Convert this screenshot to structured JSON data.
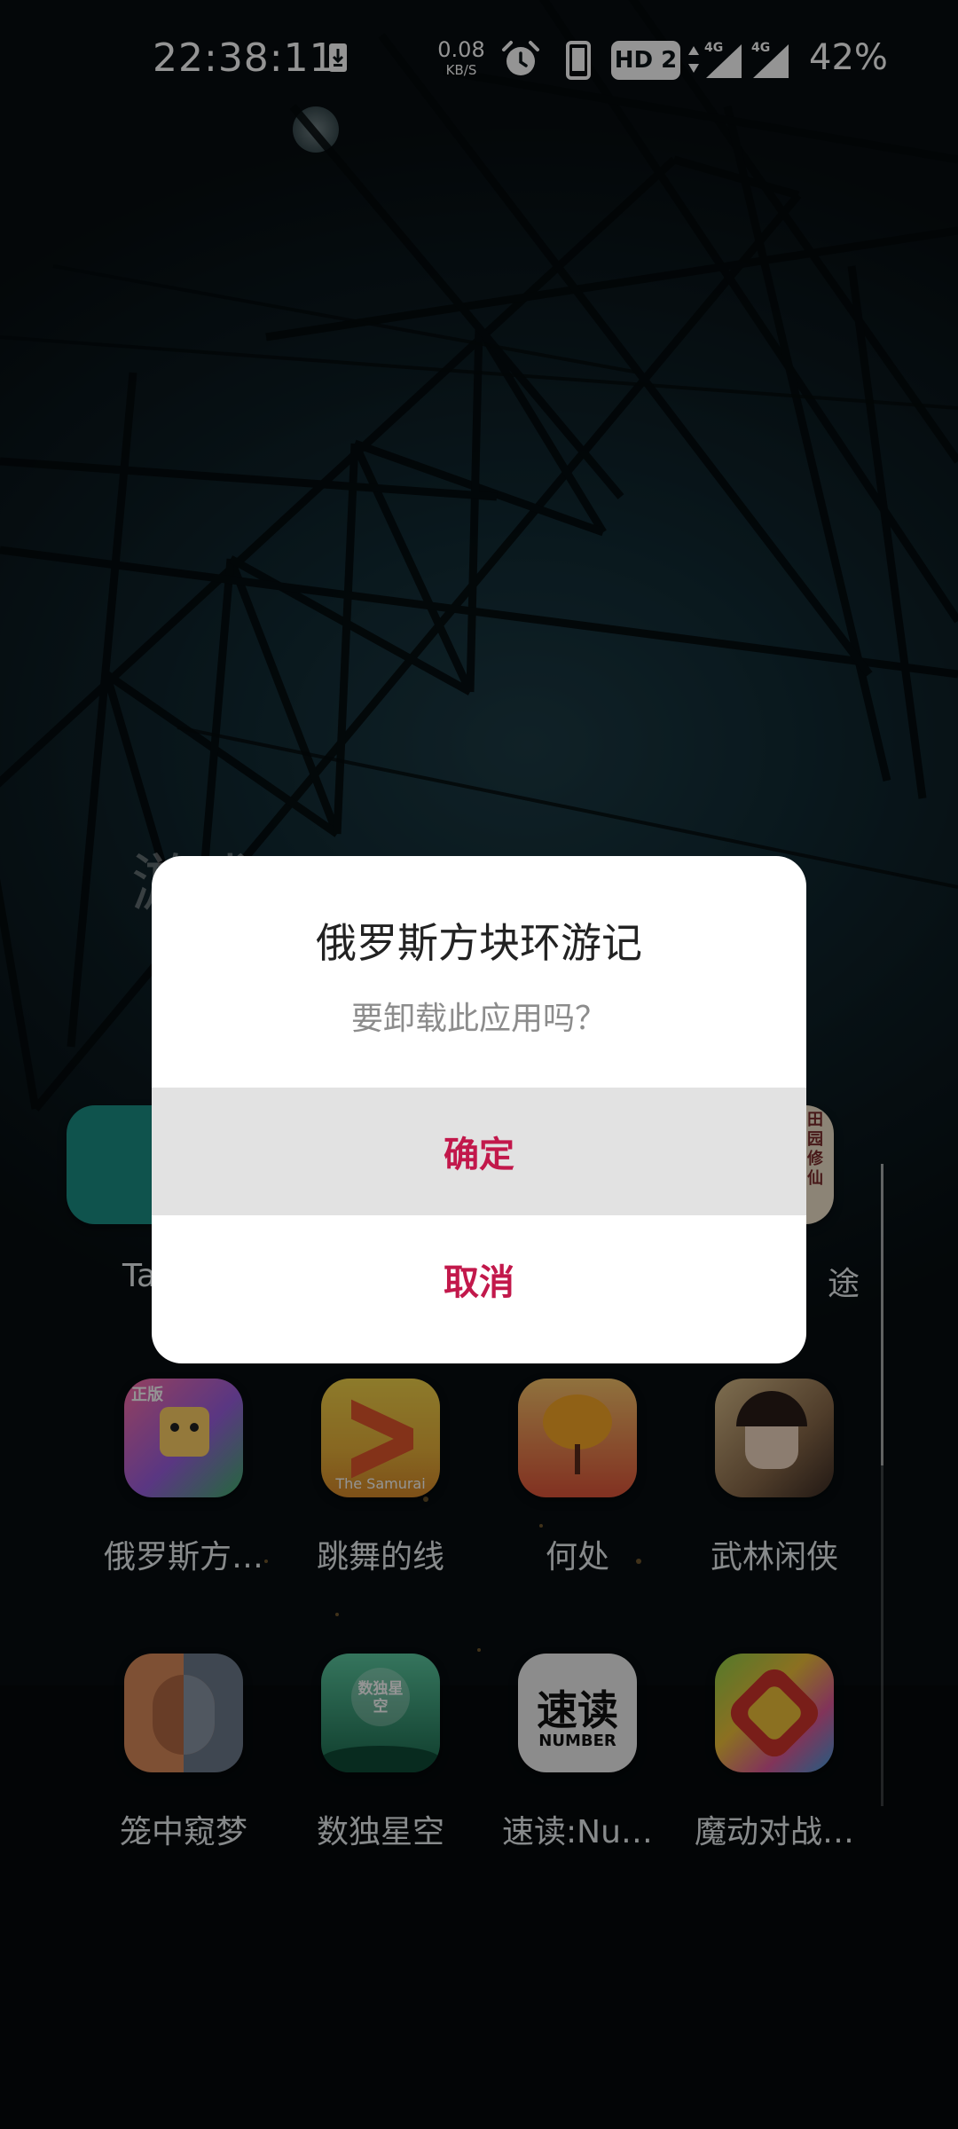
{
  "status_bar": {
    "time": "22:38:11",
    "net_speed_value": "0.08",
    "net_speed_unit": "KB/S",
    "hd_badge": "HD 2",
    "signal_1_label": "4G",
    "signal_2_label": "4G",
    "battery": "42%",
    "icons": [
      "download-icon",
      "alarm-icon",
      "phone-icon",
      "updown-arrows-icon",
      "signal-icon",
      "signal-icon"
    ]
  },
  "folder": {
    "title": "游戏",
    "partial_row": [
      {
        "label": "Ta",
        "color": "#1a8f86"
      },
      {
        "label": "途",
        "icon_text": "田园修仙",
        "color": "#f1e4cc"
      }
    ],
    "apps": [
      {
        "label": "俄罗斯方…",
        "icon_text": "正版",
        "color_a": "#ff6fa4",
        "color_b": "#3fb46a"
      },
      {
        "label": "跳舞的线",
        "icon_text": "The Samurai",
        "color_a": "#f3d34a",
        "color_b": "#3aa06a"
      },
      {
        "label": "何处",
        "color_a": "#f7b24a",
        "color_b": "#e0553a"
      },
      {
        "label": "武林闲侠",
        "color_a": "#c9a77a",
        "color_b": "#4a3b32"
      },
      {
        "label": "笼中窥梦",
        "color_a": "#d98b5a",
        "color_b": "#6d7a8c"
      },
      {
        "label": "数独星空",
        "icon_text": "数独星空",
        "color_a": "#3fb48a",
        "color_b": "#1b6a4e"
      },
      {
        "label": "速读:Nu…",
        "icon_text": "速读",
        "icon_subtext": "NUMBER",
        "color_a": "#f2f2f2",
        "color_b": "#dcdcdc"
      },
      {
        "label": "魔动对战…",
        "color_a": "#f0c23a",
        "color_b": "#d0342c"
      }
    ]
  },
  "dialog": {
    "title": "俄罗斯方块环游记",
    "message": "要卸载此应用吗？",
    "confirm_label": "确定",
    "cancel_label": "取消",
    "accent": "#c2184b"
  }
}
